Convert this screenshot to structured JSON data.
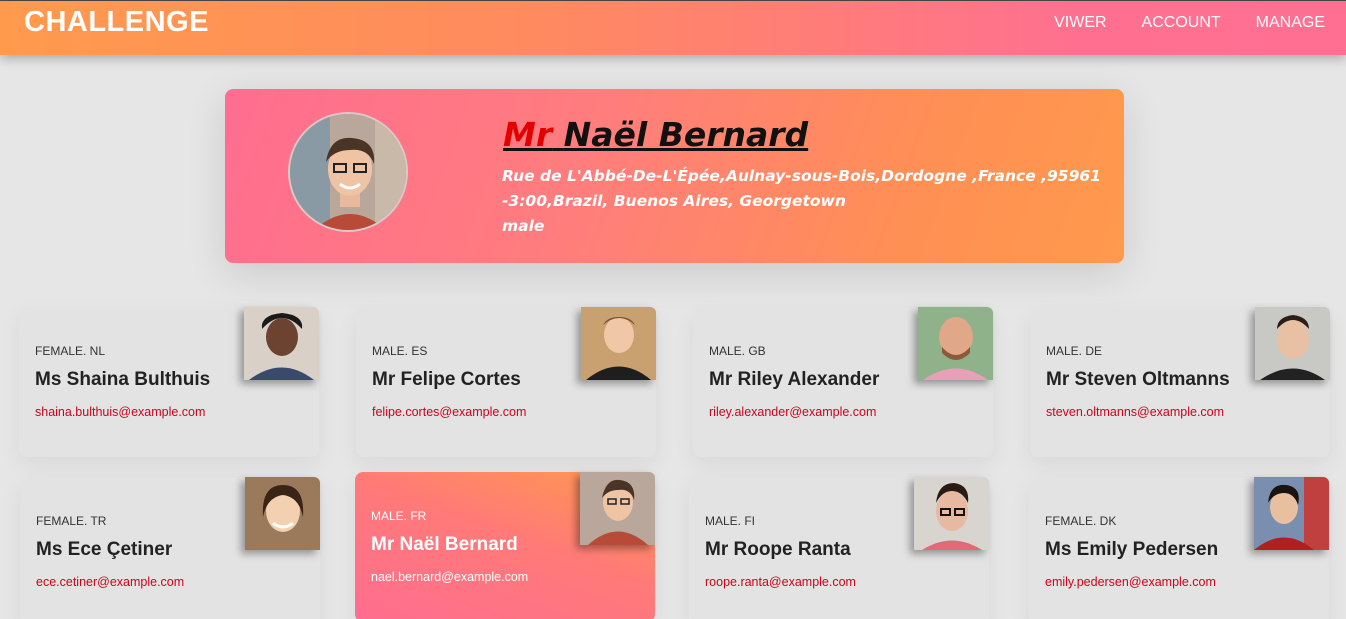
{
  "header": {
    "brand": "CHALLENGE",
    "nav": [
      "VIWER",
      "ACCOUNT",
      "MANAGE"
    ]
  },
  "featured": {
    "title": "Mr",
    "name": "Naël Bernard",
    "address": "Rue de L'Abbé-De-L'Épée,Aulnay-sous-Bois,Dordogne ,France ,95961",
    "timezone": "-3:00,Brazil, Buenos Aires, Georgetown",
    "gender": "male"
  },
  "cards": [
    {
      "meta": "FEMALE. NL",
      "name": "Ms Shaina Bulthuis",
      "email": "shaina.bulthuis@example.com"
    },
    {
      "meta": "MALE. ES",
      "name": "Mr Felipe Cortes",
      "email": "felipe.cortes@example.com"
    },
    {
      "meta": "MALE. GB",
      "name": "Mr Riley Alexander",
      "email": "riley.alexander@example.com"
    },
    {
      "meta": "MALE. DE",
      "name": "Mr Steven Oltmanns",
      "email": "steven.oltmanns@example.com"
    },
    {
      "meta": "FEMALE. TR",
      "name": "Ms Ece Çetiner",
      "email": "ece.cetiner@example.com"
    },
    {
      "meta": "MALE. FR",
      "name": "Mr Naël Bernard",
      "email": "nael.bernard@example.com"
    },
    {
      "meta": "MALE. FI",
      "name": "Mr Roope Ranta",
      "email": "roope.ranta@example.com"
    },
    {
      "meta": "FEMALE. DK",
      "name": "Ms Emily Pedersen",
      "email": "emily.pedersen@example.com"
    }
  ],
  "colors": {
    "accent_orange": "#ff9a4d",
    "accent_pink": "#ff6f92",
    "email_red": "#d0021b",
    "title_red": "#e30000"
  },
  "icons": [
    "avatar-photo"
  ]
}
